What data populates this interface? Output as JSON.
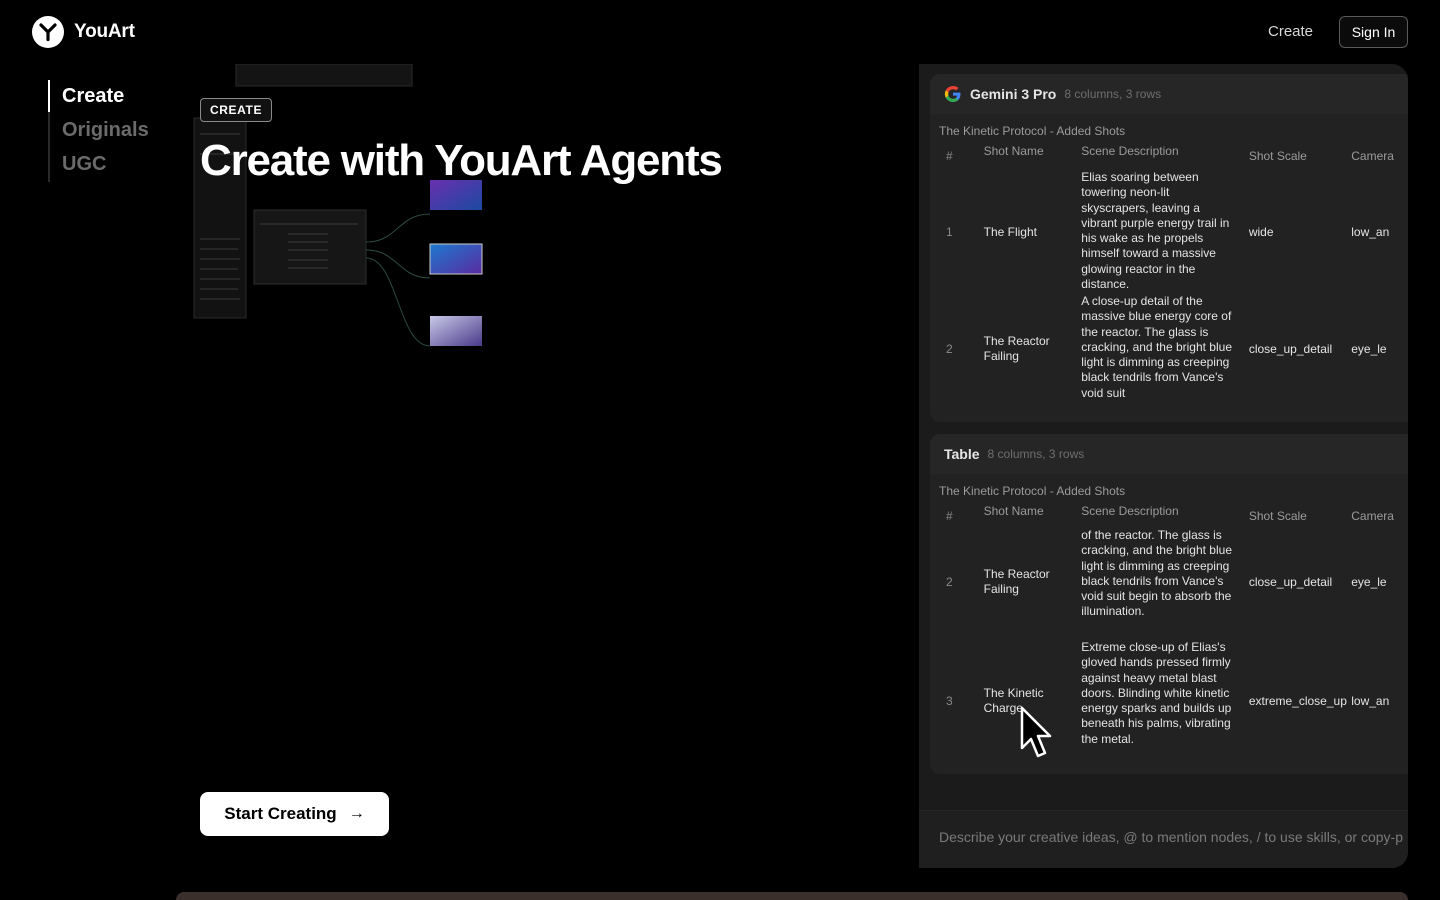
{
  "brand": {
    "name": "YouArt"
  },
  "nav": {
    "create": "Create",
    "sign_in": "Sign In"
  },
  "side_tabs": [
    {
      "label": "Create",
      "active": true
    },
    {
      "label": "Originals",
      "active": false
    },
    {
      "label": "UGC",
      "active": false
    }
  ],
  "hero": {
    "badge": "CREATE",
    "title": "Create with YouArt Agents",
    "cta": "Start Creating"
  },
  "agent_panel": {
    "card1": {
      "name": "Gemini 3 Pro",
      "meta": "8 columns, 3 rows",
      "caption": "The Kinetic Protocol - Added Shots",
      "columns": [
        "#",
        "Shot Name",
        "Scene Description",
        "Shot Scale",
        "Camera"
      ],
      "rows": [
        {
          "num": "1",
          "name": "The Flight",
          "desc": "Elias soaring between towering neon-lit skyscrapers, leaving a vibrant purple energy trail in his wake as he propels himself toward a massive glowing reactor in the distance.",
          "scale": "wide",
          "camera": "low_an"
        },
        {
          "num": "2",
          "name": "The Reactor Failing",
          "desc": "A close-up detail of the massive blue energy core of the reactor. The glass is cracking, and the bright blue light is dimming as creeping black tendrils from Vance's void suit",
          "scale": "close_up_detail",
          "camera": "eye_le"
        }
      ]
    },
    "card2": {
      "name": "Table",
      "meta": "8 columns, 3 rows",
      "caption": "The Kinetic Protocol - Added Shots",
      "columns": [
        "#",
        "Shot Name",
        "Scene Description",
        "Shot Scale",
        "Camera"
      ],
      "rows": [
        {
          "num": "2",
          "name": "The Reactor Failing",
          "desc": "of the reactor. The glass is cracking, and the bright blue light is dimming as creeping black tendrils from Vance's void suit begin to absorb the illumination.",
          "scale": "close_up_detail",
          "camera": "eye_le"
        },
        {
          "num": "3",
          "name": "The Kinetic Charge",
          "desc": "Extreme close-up of Elias's gloved hands pressed firmly against heavy metal blast doors. Blinding white kinetic energy sparks and builds up beneath his palms, vibrating the metal.",
          "scale": "extreme_close_up",
          "camera": "low_an"
        }
      ]
    },
    "input_placeholder": "Describe your creative ideas, @ to mention nodes, / to use skills, or copy-p"
  },
  "icons": {
    "logo": "youart-logo-icon",
    "google": "google-g-icon",
    "arrow": "arrow-right-icon",
    "cursor": "mouse-pointer-icon"
  }
}
